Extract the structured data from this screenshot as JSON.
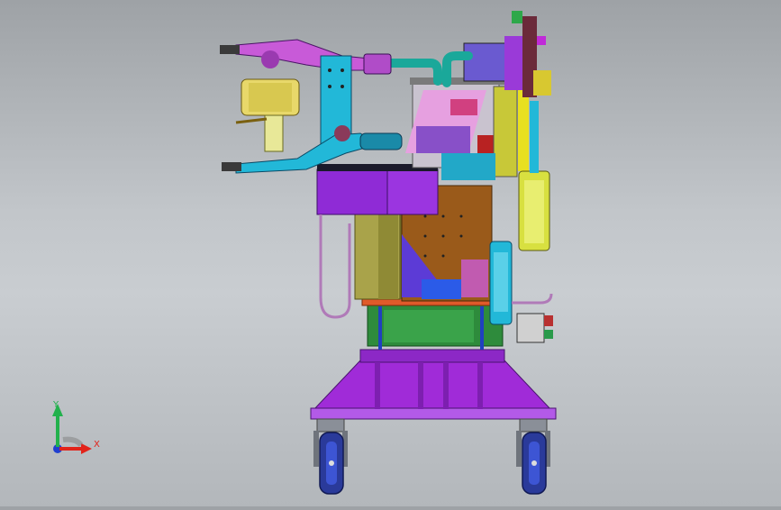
{
  "viewport": {
    "background_top": "#9ea2a6",
    "background_bottom": "#c9cdd1"
  },
  "model": {
    "icon": "cad-welding-fixture-assembly"
  },
  "triad": {
    "x_label": "X",
    "y_label": "Y",
    "x_color": "#e2231a",
    "y_color": "#22b14c",
    "z_color": "#1f3fd0"
  }
}
